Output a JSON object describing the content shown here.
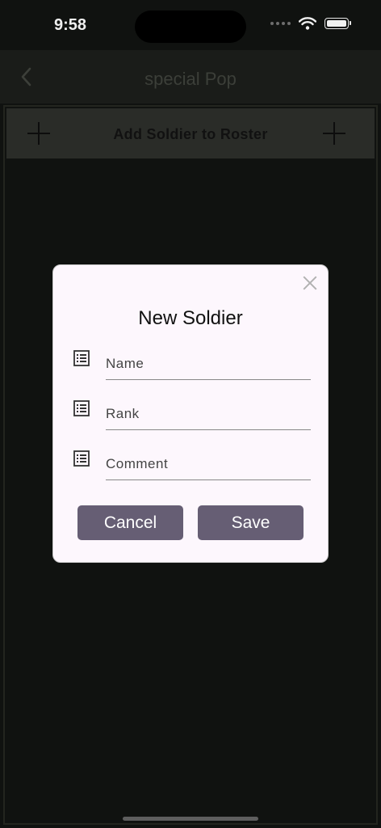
{
  "status_bar": {
    "time": "9:58"
  },
  "nav": {
    "title": "special Pop"
  },
  "add_bar": {
    "label": "Add Soldier to Roster"
  },
  "dialog": {
    "title": "New Soldier",
    "fields": [
      {
        "placeholder": "Name",
        "value": "",
        "icon": "list-icon"
      },
      {
        "placeholder": "Rank",
        "value": "",
        "icon": "list-icon"
      },
      {
        "placeholder": "Comment",
        "value": "",
        "icon": "list-icon"
      }
    ],
    "cancel_label": "Cancel",
    "save_label": "Save"
  },
  "colors": {
    "background": "#101210",
    "nav_bar": "#1a1c19",
    "add_bar": "#2a2c28",
    "dialog_bg": "#fdf7fd",
    "button": "#665e74"
  }
}
